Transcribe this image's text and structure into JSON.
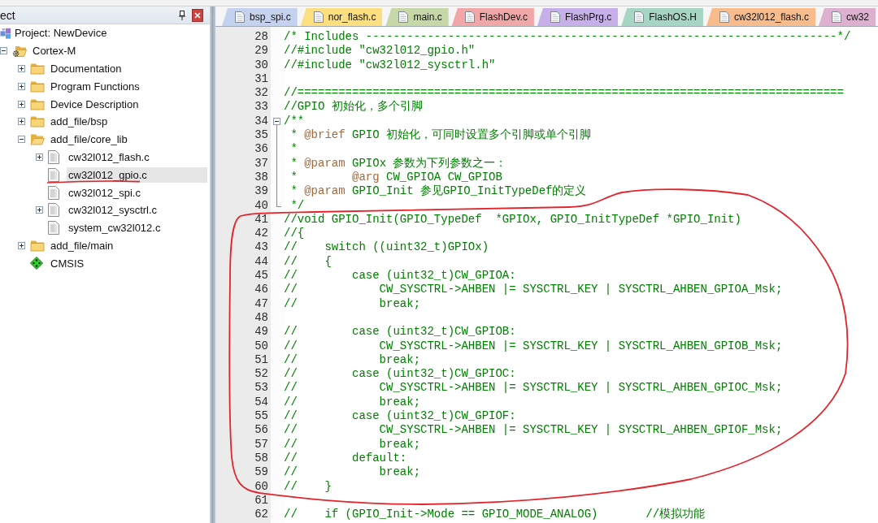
{
  "panel": {
    "title": "ect",
    "tree": [
      {
        "label": "Project: NewDevice",
        "kind": "project",
        "selected": false,
        "underlined": false,
        "children": [
          {
            "label": "Cortex-M",
            "kind": "target",
            "expanded": true,
            "selected": false,
            "underlined": false,
            "children": [
              {
                "label": "Documentation",
                "kind": "group",
                "expanded": false,
                "selected": false,
                "underlined": false
              },
              {
                "label": "Program Functions",
                "kind": "group",
                "expanded": false,
                "selected": false,
                "underlined": false
              },
              {
                "label": "Device Description",
                "kind": "group",
                "expanded": false,
                "selected": false,
                "underlined": false
              },
              {
                "label": "add_file/bsp",
                "kind": "group",
                "expanded": false,
                "selected": false,
                "underlined": false
              },
              {
                "label": "add_file/core_lib",
                "kind": "group",
                "expanded": true,
                "selected": false,
                "underlined": false,
                "children": [
                  {
                    "label": "cw32l012_flash.c",
                    "kind": "file",
                    "expanded": false,
                    "selected": false,
                    "underlined": false
                  },
                  {
                    "label": "cw32l012_gpio.c",
                    "kind": "file",
                    "selected": true,
                    "underlined": true
                  },
                  {
                    "label": "cw32l012_spi.c",
                    "kind": "file",
                    "selected": false,
                    "underlined": false
                  },
                  {
                    "label": "cw32l012_sysctrl.c",
                    "kind": "file",
                    "expanded": false,
                    "selected": false,
                    "underlined": false
                  },
                  {
                    "label": "system_cw32l012.c",
                    "kind": "file",
                    "selected": false,
                    "underlined": false
                  }
                ]
              },
              {
                "label": "add_file/main",
                "kind": "group",
                "expanded": false,
                "selected": false,
                "underlined": false
              },
              {
                "label": "CMSIS",
                "kind": "component",
                "selected": false,
                "underlined": false
              }
            ]
          }
        ]
      }
    ]
  },
  "tabs": [
    {
      "label": "bsp_spi.c",
      "color": "#c4d2f0"
    },
    {
      "label": "nor_flash.c",
      "color": "#fddf80"
    },
    {
      "label": "main.c",
      "color": "#c6d8a8"
    },
    {
      "label": "FlashDev.c",
      "color": "#f1a7a7"
    },
    {
      "label": "FlashPrg.c",
      "color": "#c7b0ea"
    },
    {
      "label": "FlashOS.H",
      "color": "#a6d6c3"
    },
    {
      "label": "cw32l012_flash.c",
      "color": "#f8bb8c"
    },
    {
      "label": "cw32",
      "color": "#deb0cf"
    }
  ],
  "editor": {
    "blocks": [
      {
        "circled": false,
        "lines": [
          {
            "number": "28",
            "tokens": [
              {
                "kind": "comment",
                "text": "/* Includes ---------------------------------------------------------------------*/"
              }
            ]
          },
          {
            "number": "29",
            "tokens": [
              {
                "kind": "comment",
                "text": "//#include \"cw32l012_gpio.h\""
              }
            ]
          },
          {
            "number": "30",
            "tokens": [
              {
                "kind": "comment",
                "text": "//#include \"cw32l012_sysctrl.h\""
              }
            ]
          },
          {
            "number": "31"
          },
          {
            "number": "32",
            "tokens": [
              {
                "kind": "comment",
                "text": "//================================================================================"
              }
            ]
          },
          {
            "number": "33",
            "tokens": [
              {
                "kind": "comment",
                "text": "//GPIO 初始化，多个引脚"
              }
            ]
          },
          {
            "number": "34",
            "expanded": true,
            "tokens": [
              {
                "kind": "comment",
                "text": "/**"
              }
            ],
            "children": [
              {
                "number": "35",
                "tokens": [
                  {
                    "kind": "comment",
                    "text": " * "
                  },
                  {
                    "kind": "doc_tag",
                    "text": "@brief"
                  },
                  {
                    "kind": "comment",
                    "text": " GPIO 初始化，可同时设置多个引脚或单个引脚"
                  }
                ]
              },
              {
                "number": "36",
                "tokens": [
                  {
                    "kind": "comment",
                    "text": " *"
                  }
                ]
              },
              {
                "number": "37",
                "tokens": [
                  {
                    "kind": "comment",
                    "text": " * "
                  },
                  {
                    "kind": "doc_tag",
                    "text": "@param"
                  },
                  {
                    "kind": "comment",
                    "text": " GPIOx 参数为下列参数之一："
                  }
                ]
              },
              {
                "number": "38",
                "tokens": [
                  {
                    "kind": "comment",
                    "text": " *        "
                  },
                  {
                    "kind": "doc_tag",
                    "text": "@arg"
                  },
                  {
                    "kind": "comment",
                    "text": " CW_GPIOA CW_GPIOB"
                  }
                ]
              },
              {
                "number": "39",
                "tokens": [
                  {
                    "kind": "comment",
                    "text": " * "
                  },
                  {
                    "kind": "doc_tag",
                    "text": "@param"
                  },
                  {
                    "kind": "comment",
                    "text": " GPIO_Init 参见GPIO_InitTypeDef的定义"
                  }
                ]
              },
              {
                "number": "40",
                "tokens": [
                  {
                    "kind": "comment",
                    "text": " */"
                  }
                ]
              }
            ]
          }
        ]
      },
      {
        "circled": true,
        "lines": [
          {
            "number": "41",
            "tokens": [
              {
                "kind": "comment",
                "text": "//void GPIO_Init(GPIO_TypeDef  *GPIOx, GPIO_InitTypeDef *GPIO_Init)"
              }
            ]
          },
          {
            "number": "42",
            "tokens": [
              {
                "kind": "comment",
                "text": "//{"
              }
            ]
          },
          {
            "number": "43",
            "tokens": [
              {
                "kind": "comment",
                "text": "//    switch ((uint32_t)GPIOx)"
              }
            ]
          },
          {
            "number": "44",
            "tokens": [
              {
                "kind": "comment",
                "text": "//    {"
              }
            ]
          },
          {
            "number": "45",
            "tokens": [
              {
                "kind": "comment",
                "text": "//        case (uint32_t)CW_GPIOA:"
              }
            ]
          },
          {
            "number": "46",
            "tokens": [
              {
                "kind": "comment",
                "text": "//            CW_SYSCTRL->AHBEN |= SYSCTRL_KEY | SYSCTRL_AHBEN_GPIOA_Msk;"
              }
            ]
          },
          {
            "number": "47",
            "tokens": [
              {
                "kind": "comment",
                "text": "//            break;"
              }
            ]
          },
          {
            "number": "48"
          },
          {
            "number": "49",
            "tokens": [
              {
                "kind": "comment",
                "text": "//        case (uint32_t)CW_GPIOB:"
              }
            ]
          },
          {
            "number": "50",
            "tokens": [
              {
                "kind": "comment",
                "text": "//            CW_SYSCTRL->AHBEN |= SYSCTRL_KEY | SYSCTRL_AHBEN_GPIOB_Msk;"
              }
            ]
          },
          {
            "number": "51",
            "tokens": [
              {
                "kind": "comment",
                "text": "//            break;"
              }
            ]
          },
          {
            "number": "52",
            "tokens": [
              {
                "kind": "comment",
                "text": "//        case (uint32_t)CW_GPIOC:"
              }
            ]
          },
          {
            "number": "53",
            "tokens": [
              {
                "kind": "comment",
                "text": "//            CW_SYSCTRL->AHBEN |= SYSCTRL_KEY | SYSCTRL_AHBEN_GPIOC_Msk;"
              }
            ]
          },
          {
            "number": "54",
            "tokens": [
              {
                "kind": "comment",
                "text": "//            break;"
              }
            ]
          },
          {
            "number": "55",
            "tokens": [
              {
                "kind": "comment",
                "text": "//        case (uint32_t)CW_GPIOF:"
              }
            ]
          },
          {
            "number": "56",
            "tokens": [
              {
                "kind": "comment",
                "text": "//            CW_SYSCTRL->AHBEN |= SYSCTRL_KEY | SYSCTRL_AHBEN_GPIOF_Msk;"
              }
            ]
          },
          {
            "number": "57",
            "tokens": [
              {
                "kind": "comment",
                "text": "//            break;"
              }
            ]
          },
          {
            "number": "58",
            "tokens": [
              {
                "kind": "comment",
                "text": "//        default:"
              }
            ]
          },
          {
            "number": "59",
            "tokens": [
              {
                "kind": "comment",
                "text": "//            break;"
              }
            ]
          },
          {
            "number": "60",
            "tokens": [
              {
                "kind": "comment",
                "text": "//    }"
              }
            ]
          }
        ]
      },
      {
        "circled": false,
        "lines": [
          {
            "number": "61"
          },
          {
            "number": "62",
            "tokens": [
              {
                "kind": "comment",
                "text": "//    if (GPIO_Init->Mode == GPIO_MODE_ANALOG)       //模拟功能"
              }
            ]
          }
        ]
      }
    ]
  }
}
